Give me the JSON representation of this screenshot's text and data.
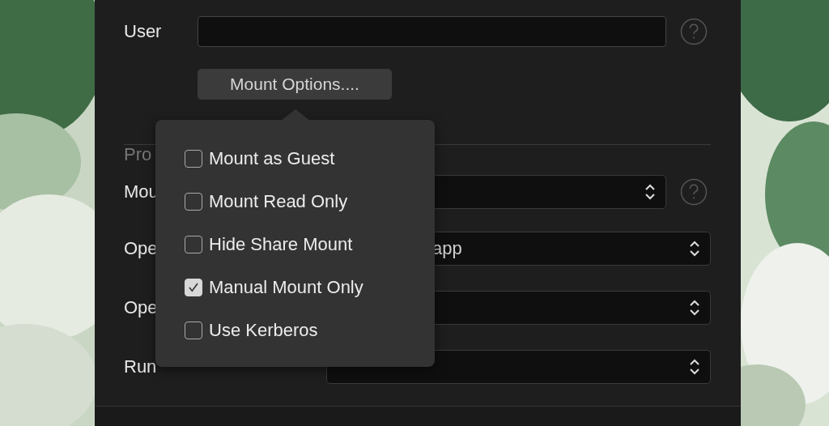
{
  "user_field": {
    "label": "User",
    "help": true
  },
  "mount_options_button": "Mount Options....",
  "mount_options_popover": {
    "items": [
      {
        "label": "Mount as Guest",
        "checked": false
      },
      {
        "label": "Mount Read Only",
        "checked": false
      },
      {
        "label": "Hide Share Mount",
        "checked": false
      },
      {
        "label": "Manual Mount Only",
        "checked": true
      },
      {
        "label": "Use Kerberos",
        "checked": false
      }
    ]
  },
  "section_heading": "Pro",
  "rows": [
    {
      "label": "Mou",
      "help": true
    },
    {
      "label": "Ope",
      "value": "app",
      "help": false
    },
    {
      "label": "Ope",
      "help": false
    },
    {
      "label": "Run",
      "help": false
    }
  ]
}
